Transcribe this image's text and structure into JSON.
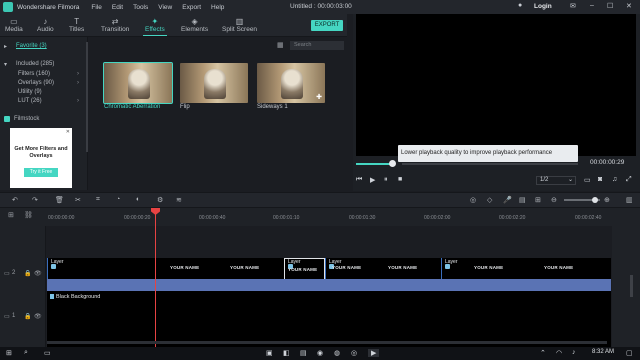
{
  "titlebar": {
    "app_name": "Wondershare Filmora",
    "menu": [
      "File",
      "Edit",
      "Tools",
      "View",
      "Export",
      "Help"
    ],
    "document_title": "Untitled : 00:00:03:00",
    "login_label": "Login"
  },
  "media_tabs": [
    {
      "label": "Media",
      "icon": "folder-icon"
    },
    {
      "label": "Audio",
      "icon": "music-icon"
    },
    {
      "label": "Titles",
      "icon": "text-icon"
    },
    {
      "label": "Transition",
      "icon": "transition-icon"
    },
    {
      "label": "Effects",
      "icon": "effects-icon",
      "active": true
    },
    {
      "label": "Elements",
      "icon": "elements-icon"
    },
    {
      "label": "Split Screen",
      "icon": "split-screen-icon"
    }
  ],
  "export_label": "EXPORT",
  "left_nav": {
    "favorite": "Favorite (3)",
    "included": "Included (285)",
    "items": [
      "Filters (160)",
      "Overlays (90)",
      "Utility (9)",
      "LUT (26)"
    ],
    "filmstock": "Filmstock",
    "ad_title": "Get More Filters and Overlays",
    "ad_button": "Try it Free"
  },
  "search": {
    "placeholder": "Search"
  },
  "effects": [
    {
      "label": "Chromatic Aberration",
      "selected": true
    },
    {
      "label": "Flip",
      "selected": false
    },
    {
      "label": "Sideways 1",
      "selected": false
    }
  ],
  "preview": {
    "tooltip": "Lower playback quality to improve playback performance",
    "timecode": "00:00:00:29",
    "quality": "1/2",
    "progress_fraction": 0.16
  },
  "ruler_ticks": [
    "00:00:00:00",
    "00:00:00:20",
    "00:00:00:40",
    "00:00:01:10",
    "00:00:01:30",
    "00:00:02:00",
    "00:00:02:20",
    "00:00:02:40"
  ],
  "tracks": {
    "video_track_num": "2",
    "bg_track_num": "1",
    "clips": [
      {
        "label": "Layer",
        "text": "YOUR NAME"
      },
      {
        "label": "Layer",
        "text": "YOUR NAME"
      },
      {
        "label": "Layer",
        "text": "YOUR NAME"
      },
      {
        "label": "Layer",
        "text": "YOUR NAME"
      }
    ],
    "background_label": "Black Background"
  },
  "taskbar": {
    "time": "8:32 AM"
  },
  "colors": {
    "accent": "#45d6c2",
    "playhead": "#e64343",
    "audio": "#5a73b4"
  }
}
